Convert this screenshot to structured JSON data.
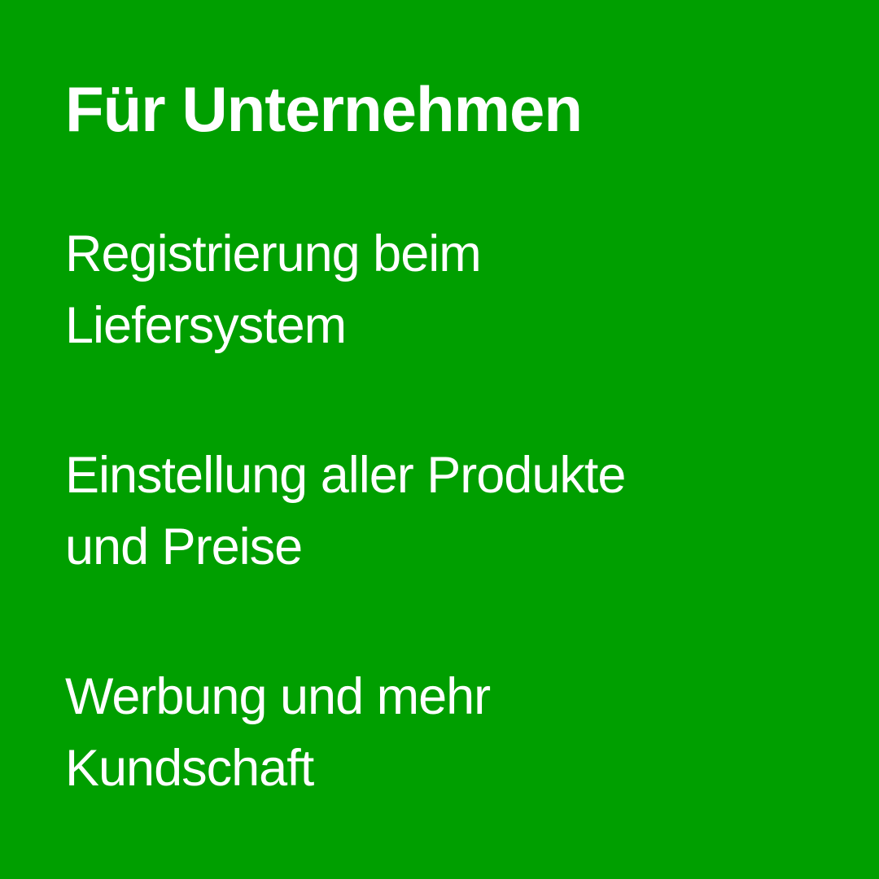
{
  "background_color": "#009f00",
  "text_color": "#ffffff",
  "heading": "Für Unternehmen",
  "items": [
    {
      "line1": "Registrierung beim",
      "line2": "Liefersystem"
    },
    {
      "line1": "Einstellung aller Produkte",
      "line2": "und Preise"
    },
    {
      "line1": "Werbung und mehr",
      "line2": "Kundschaft"
    }
  ]
}
